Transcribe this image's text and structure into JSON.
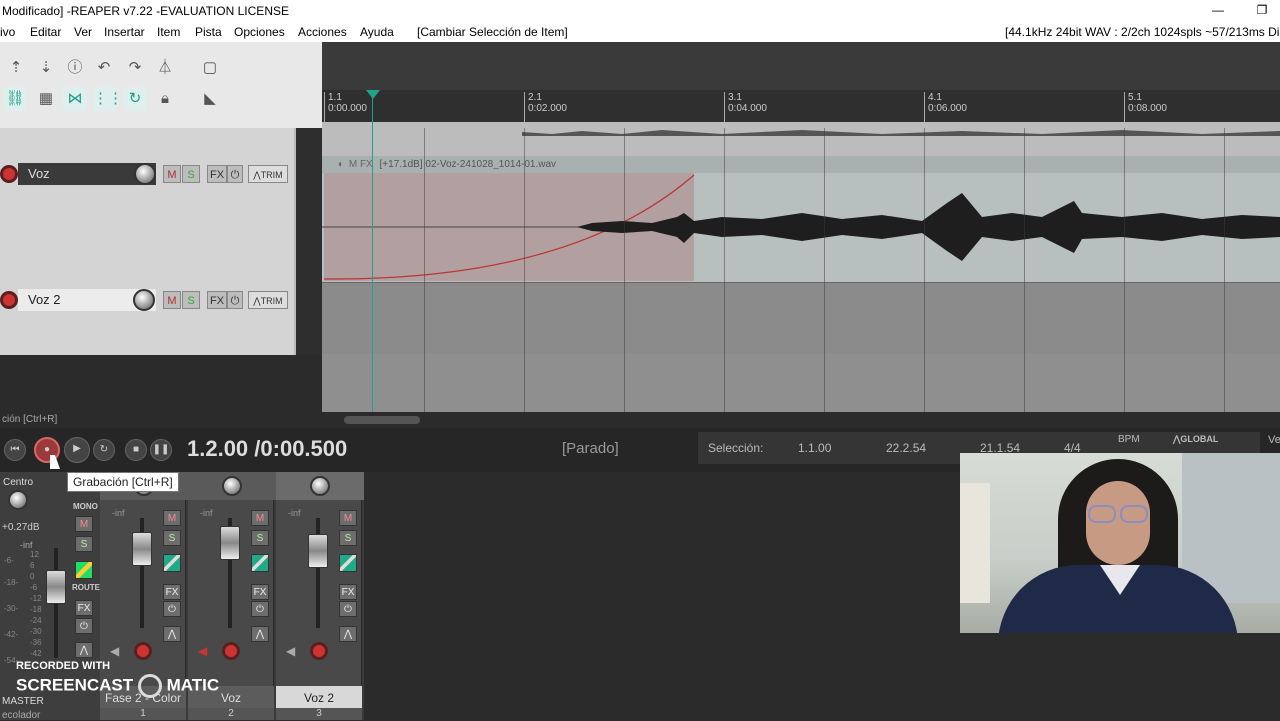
{
  "window": {
    "title": "Modificado] -REAPER v7.22 -EVALUATION LICENSE",
    "minimize_glyph": "—",
    "restore_glyph": "❐"
  },
  "menu": {
    "items": [
      "ivo",
      "Editar",
      "Ver",
      "Insertar",
      "Item",
      "Pista",
      "Opciones",
      "Acciones",
      "Ayuda"
    ],
    "action_hint": "[Cambiar Selección de Item]",
    "audio_info": "[44.1kHz 24bit WAV : 2/2ch 1024spls ~57/213ms Dire"
  },
  "ruler": {
    "marks": [
      {
        "bar": "1.1",
        "time": "0:00.000"
      },
      {
        "bar": "2.1",
        "time": "0:02.000"
      },
      {
        "bar": "3.1",
        "time": "0:04.000"
      },
      {
        "bar": "4.1",
        "time": "0:06.000"
      },
      {
        "bar": "5.1",
        "time": "0:08.000"
      }
    ]
  },
  "tracks": [
    {
      "name": "Voz",
      "m": "M",
      "s": "S",
      "fx": "FX",
      "trim": "TRIM"
    },
    {
      "name": "Voz 2",
      "m": "M",
      "s": "S",
      "fx": "FX",
      "trim": "TRIM"
    }
  ],
  "item": {
    "label": "[+17.1dB] 02-Voz-241028_1014-01.wav"
  },
  "status": {
    "left": "ción [Ctrl+R]"
  },
  "transport": {
    "timecode": "1.2.00 /0:00.500",
    "state": "[Parado]",
    "selection_label": "Selección:",
    "sel_start": "1.1.00",
    "sel_end": "22.2.54",
    "sel_len": "21.1.54",
    "time_sig": "4/4",
    "bpm_label": "BPM",
    "global_label": "GLOBAL",
    "ve": "Ve"
  },
  "tooltip": "Grabación [Ctrl+R]",
  "mixer": {
    "master": {
      "pan_label": "Centro",
      "gain": "+0.27dB",
      "inf": "-inf",
      "mono": "MONO",
      "route": "ROUTE",
      "m": "M",
      "s": "S",
      "fx": "FX",
      "name": "MASTER",
      "scale": [
        "12",
        "6",
        "0",
        "-6",
        "-12",
        "-18",
        "-24",
        "-30",
        "-36",
        "-42"
      ],
      "left_scale": [
        "-6-",
        "-18-",
        "-30-",
        "-42-",
        "-54-"
      ]
    },
    "strips": [
      {
        "name": "Fase 2 - Color",
        "num": "1",
        "inf": "-inf",
        "m": "M",
        "s": "S",
        "fx": "FX"
      },
      {
        "name": "Voz",
        "num": "2",
        "inf": "-inf",
        "m": "M",
        "s": "S",
        "fx": "FX"
      },
      {
        "name": "Voz 2",
        "num": "3",
        "inf": "-inf",
        "m": "M",
        "s": "S",
        "fx": "FX"
      }
    ],
    "bottom_label": "ecolador"
  },
  "watermark": {
    "line1": "RECORDED WITH",
    "line2a": "SCREENCAST",
    "line2b": "MATIC"
  },
  "colors": {
    "accent": "#1fa38e",
    "record": "#cc3333"
  }
}
